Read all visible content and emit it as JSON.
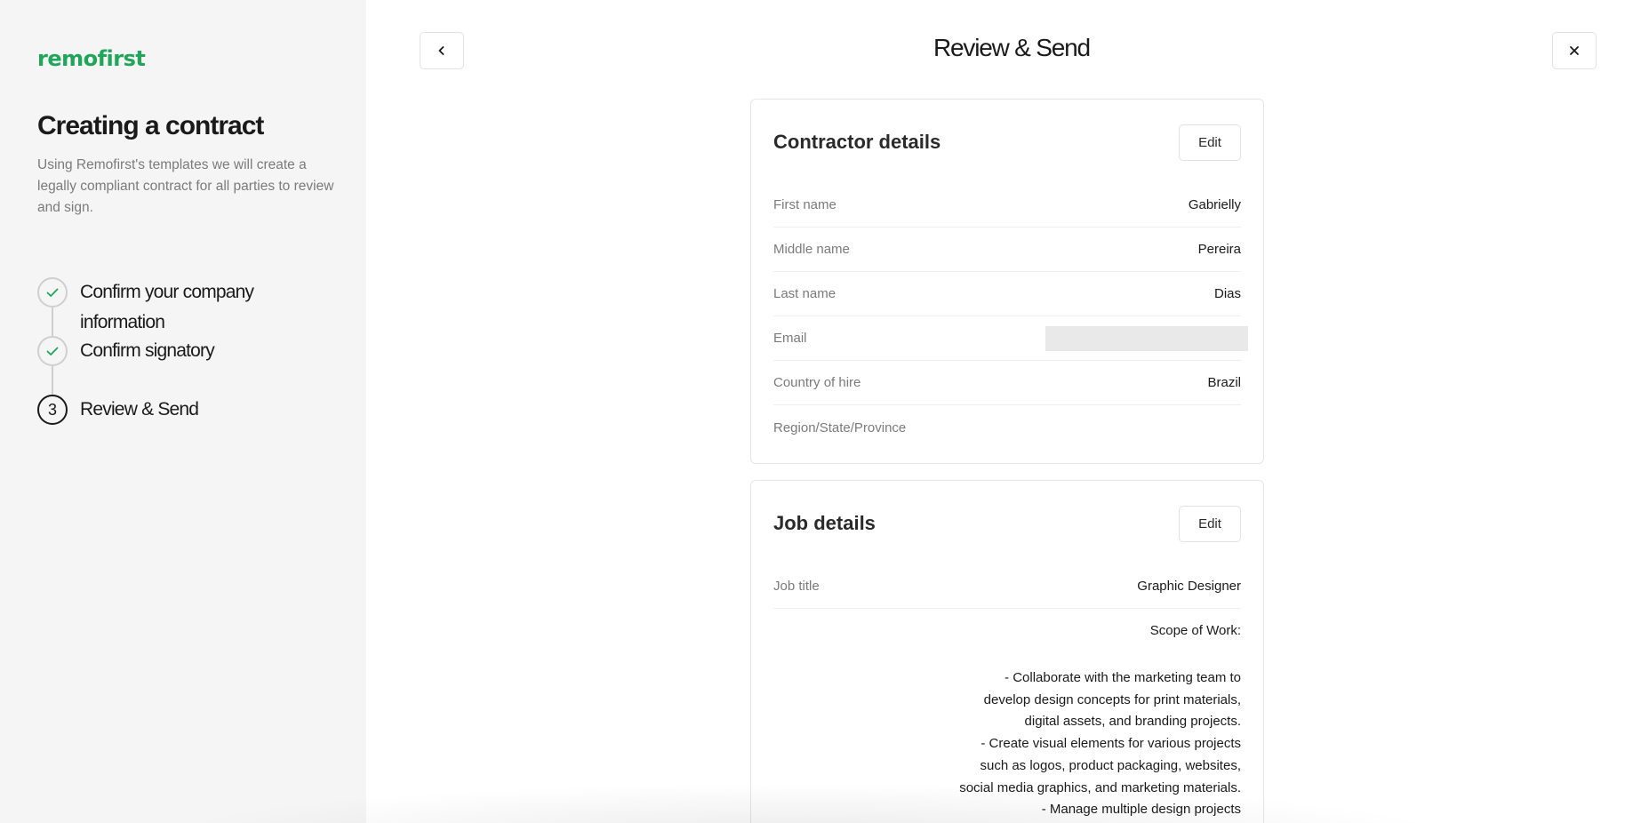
{
  "sidebar": {
    "logo": "remofirst",
    "title": "Creating a contract",
    "description": "Using Remofirst's templates we will create a legally compliant contract for all parties to review and sign.",
    "steps": [
      {
        "label": "Confirm your company information",
        "status": "done"
      },
      {
        "label": "Confirm signatory",
        "status": "done"
      },
      {
        "label": "Review & Send",
        "status": "current",
        "number": "3"
      }
    ]
  },
  "header": {
    "title": "Review & Send",
    "back_icon": "chevron-left-icon",
    "close_icon": "close-icon"
  },
  "contractor": {
    "title": "Contractor details",
    "edit_label": "Edit",
    "rows": [
      {
        "label": "First name",
        "value": "Gabrielly"
      },
      {
        "label": "Middle name",
        "value": "Pereira"
      },
      {
        "label": "Last name",
        "value": "Dias"
      },
      {
        "label": "Email",
        "value": ""
      },
      {
        "label": "Country of hire",
        "value": "Brazil"
      },
      {
        "label": "Region/State/Province",
        "value": ""
      }
    ]
  },
  "job": {
    "title": "Job details",
    "edit_label": "Edit",
    "job_title_label": "Job title",
    "job_title_value": "Graphic Designer",
    "scope_heading": "Scope of Work:",
    "scope_text": "- Collaborate with the marketing team to develop design concepts for print materials, digital assets, and branding projects.\n- Create visual elements for various projects such as logos, product packaging, websites, social media graphics, and marketing materials.\n- Manage multiple design projects"
  },
  "colors": {
    "brand": "#1fa65a",
    "sidebar_bg": "#f5f5f5",
    "check": "#1fa65a"
  }
}
